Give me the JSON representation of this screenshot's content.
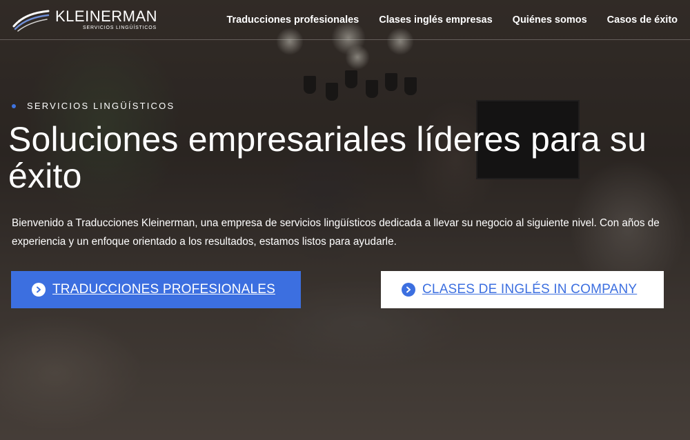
{
  "brand": {
    "name": "KLEINERMAN",
    "subtitle": "SERVICIOS LINGÜÍSTICOS"
  },
  "nav": {
    "items": [
      {
        "label": "Traducciones profesionales"
      },
      {
        "label": "Clases inglés empresas"
      },
      {
        "label": "Quiénes somos"
      },
      {
        "label": "Casos de éxito"
      }
    ]
  },
  "hero": {
    "eyebrow": "SERVICIOS LINGÜÍSTICOS",
    "title": "Soluciones empresariales líderes para su éxito",
    "intro": "Bienvenido a Traducciones Kleinerman, una empresa de servicios lingüísticos dedicada a llevar su negocio al siguiente nivel. Con años de experiencia y un enfoque orientado a los resultados, estamos listos para ayudarle.",
    "primary_cta": "TRADUCCIONES PROFESIONALES",
    "secondary_cta": "CLASES DE INGLÉS IN COMPANY"
  },
  "colors": {
    "accent": "#3c6fe0",
    "text_light": "#ffffff"
  },
  "icons": {
    "cta": "chevron-circle-right-icon",
    "logo": "kleinerman-swoosh-logo"
  }
}
